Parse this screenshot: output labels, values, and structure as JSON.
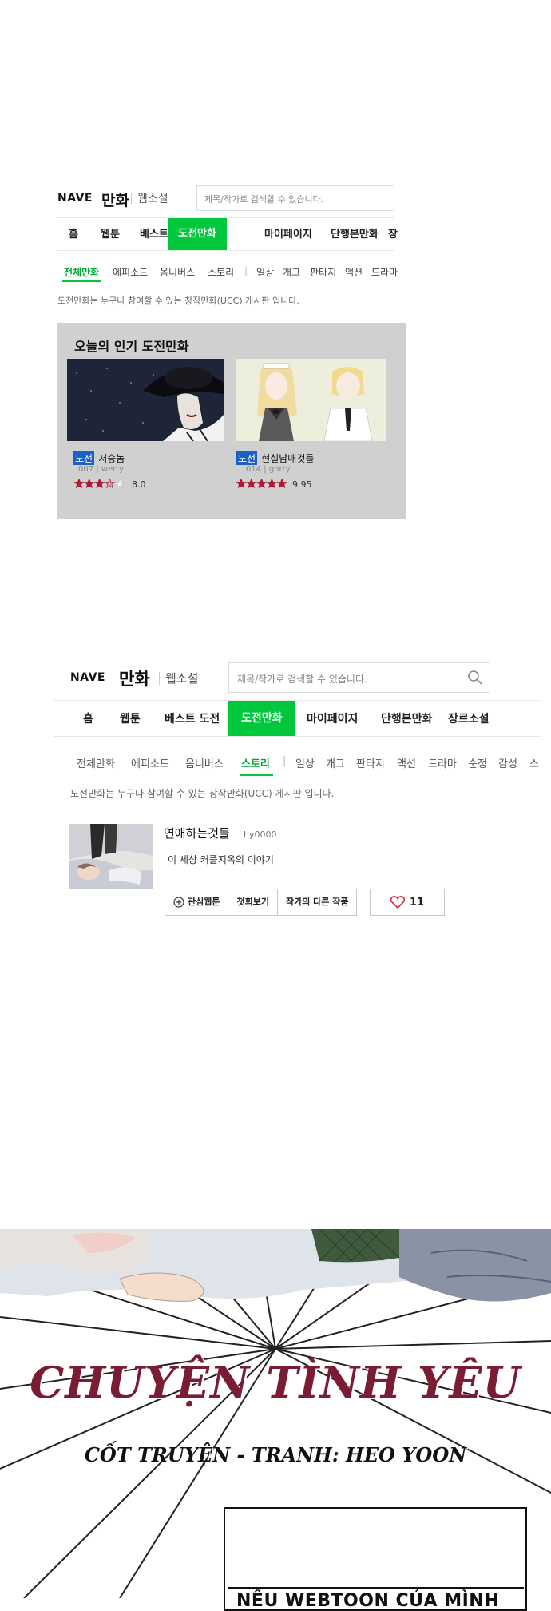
{
  "panel1": {
    "logo": "NAVE",
    "title": "만화",
    "web_novel": "웹소설",
    "search_placeholder": "제목/작가로 검색할 수 있습니다.",
    "nav": [
      "홈",
      "웹툰",
      "베스트 도전",
      "도전만화",
      "마이페이지",
      "단행본만화",
      "장"
    ],
    "active_nav": "도전만화",
    "subnav": [
      "전체만화",
      "에피소드",
      "옴니버스",
      "스토리",
      "|",
      "일상",
      "개그",
      "판타지",
      "액션",
      "드라마"
    ],
    "active_subnav": "전체만화",
    "description": "도전만화는 누구나 참여할 수 있는 창작만화(UCC) 게시판 입니다.",
    "popular": {
      "heading": "오늘의 인기 도전만화",
      "cards": [
        {
          "badge": "도전",
          "title": "저승놈",
          "meta": "007 | werty",
          "stars": 3.5,
          "rating": "8.0"
        },
        {
          "badge": "도전",
          "title": "현실남매것들",
          "meta": "014 | ghrty",
          "stars": 5,
          "rating": "9.95"
        }
      ]
    }
  },
  "panel2": {
    "logo": "NAVE",
    "title": "만화",
    "web_novel": "웹소설",
    "search_placeholder": "제목/작가로 검색할 수 있습니다.",
    "nav": [
      "홈",
      "웹툰",
      "베스트 도전",
      "도전만화",
      "마이페이지",
      "단행본만화",
      "장르소설"
    ],
    "active_nav": "도전만화",
    "subnav": [
      "전체만화",
      "에피소드",
      "옴니버스",
      "스토리",
      "|",
      "일상",
      "개그",
      "판타지",
      "액션",
      "드라마",
      "순정",
      "감성",
      "스"
    ],
    "active_subnav": "스토리",
    "description": "도전만화는 누구나 참여할 수 있는 창작만화(UCC) 게시판 입니다.",
    "work": {
      "title": "연애하는것들",
      "author": "hy0000",
      "summary": "이 세상 커플지옥의 이야기",
      "buttons": [
        "관심웹툰",
        "첫회보기",
        "작가의 다른 작품"
      ],
      "likes": "11"
    }
  },
  "comic": {
    "title": "CHUYỆN TÌNH YÊU",
    "credit": "CỐT TRUYỆN - TRANH: HEO YOON",
    "caption": "NẾU WEBTOON CỦA MÌNH"
  },
  "colors": {
    "accent_green": "#00c73c",
    "badge_blue": "#1b60c8",
    "title_maroon": "#7a1d34",
    "popular_bg": "#d0d0d0",
    "star_red": "#c8102e"
  }
}
